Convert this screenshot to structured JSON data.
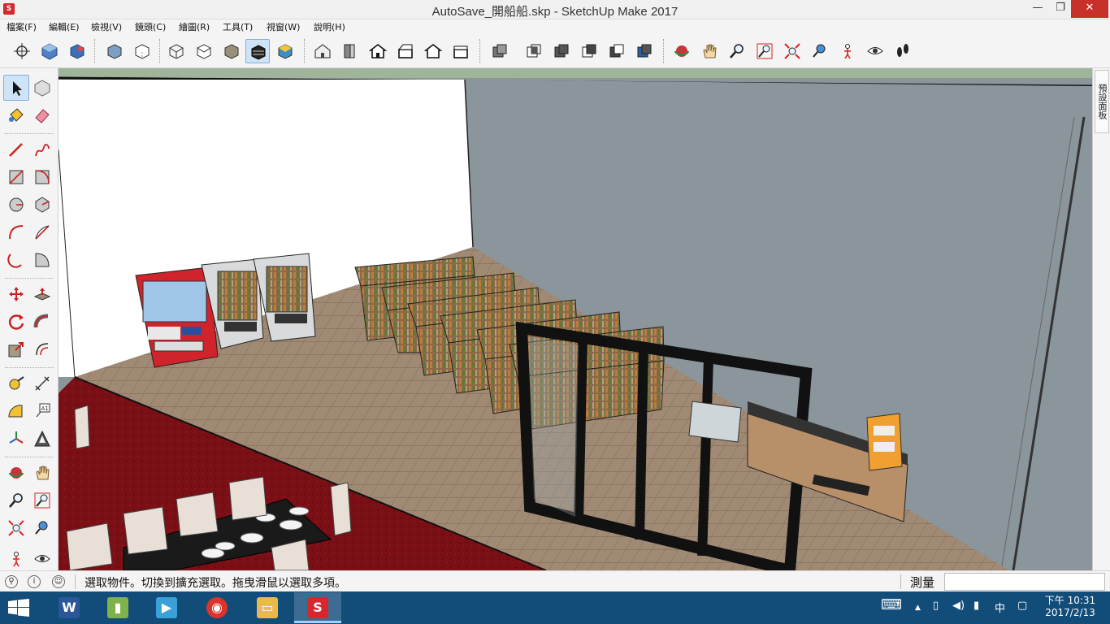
{
  "window": {
    "title": "AutoSave_開船船.skp - SketchUp Make 2017",
    "min_symbol": "—",
    "max_symbol": "❐",
    "close_symbol": "✕",
    "app_icon_letter": "S"
  },
  "menu": {
    "items": [
      {
        "label": "檔案(F)"
      },
      {
        "label": "編輯(E)"
      },
      {
        "label": "檢視(V)"
      },
      {
        "label": "鏡頭(C)"
      },
      {
        "label": "繪圖(R)"
      },
      {
        "label": "工具(T)"
      },
      {
        "label": "視窗(W)"
      },
      {
        "label": "說明(H)"
      }
    ]
  },
  "toolbar": {
    "buttons": [
      {
        "name": "axes-icon"
      },
      {
        "name": "iso-view-icon"
      },
      {
        "name": "iso-view-alt-icon"
      },
      {
        "name": "xray-style-icon"
      },
      {
        "name": "back-edges-style-icon"
      },
      {
        "name": "wireframe-style-icon"
      },
      {
        "name": "hidden-line-style-icon"
      },
      {
        "name": "shaded-style-icon"
      },
      {
        "name": "shaded-textures-style-icon"
      },
      {
        "name": "monochrome-style-icon"
      },
      {
        "name": "iso-house-icon"
      },
      {
        "name": "top-house-icon"
      },
      {
        "name": "front-house-icon"
      },
      {
        "name": "right-house-icon"
      },
      {
        "name": "back-house-icon"
      },
      {
        "name": "left-house-icon"
      },
      {
        "name": "solid-outer-shell-icon"
      },
      {
        "name": "intersect-icon"
      },
      {
        "name": "union-icon"
      },
      {
        "name": "subtract-icon"
      },
      {
        "name": "trim-icon"
      },
      {
        "name": "split-icon"
      },
      {
        "name": "orbit-icon"
      },
      {
        "name": "pan-icon"
      },
      {
        "name": "zoom-icon"
      },
      {
        "name": "zoom-window-icon"
      },
      {
        "name": "zoom-extents-icon"
      },
      {
        "name": "previous-view-icon"
      },
      {
        "name": "position-camera-icon"
      },
      {
        "name": "look-around-icon"
      },
      {
        "name": "walk-icon"
      }
    ]
  },
  "right_tray": {
    "tab_label": "預設面板"
  },
  "status": {
    "message": "選取物件。切換到擴充選取。拖曳滑鼠以選取多項。",
    "measure_label": "測量",
    "measure_value": "",
    "info_icon": "i",
    "geo_icon": "⚲",
    "user_icon": "☺"
  },
  "taskbar": {
    "apps": [
      {
        "name": "word",
        "letter": "W",
        "color": "#2b5797"
      },
      {
        "name": "sticky",
        "letter": "▮",
        "color": "#7fb24a"
      },
      {
        "name": "media",
        "letter": "▶",
        "color": "#3aa0d8"
      },
      {
        "name": "chrome",
        "letter": "◉",
        "color": "#d9352b"
      },
      {
        "name": "explorer",
        "letter": "▭",
        "color": "#e9b949"
      },
      {
        "name": "sketchup",
        "letter": "S",
        "color": "#d6262e"
      }
    ],
    "keyboard_icon": "⌨",
    "up_arrow": "▲",
    "ime_label": "中",
    "clock_ampm_time": "下午 10:31",
    "clock_date": "2017/2/13"
  },
  "colors": {
    "wall_gray": "#8a959c",
    "wall_white": "#ffffff",
    "carpet_red": "#7a1016",
    "floor_brown": "#a08a74",
    "vending_red": "#d0232b",
    "accent_active": "#cfe3f7"
  }
}
